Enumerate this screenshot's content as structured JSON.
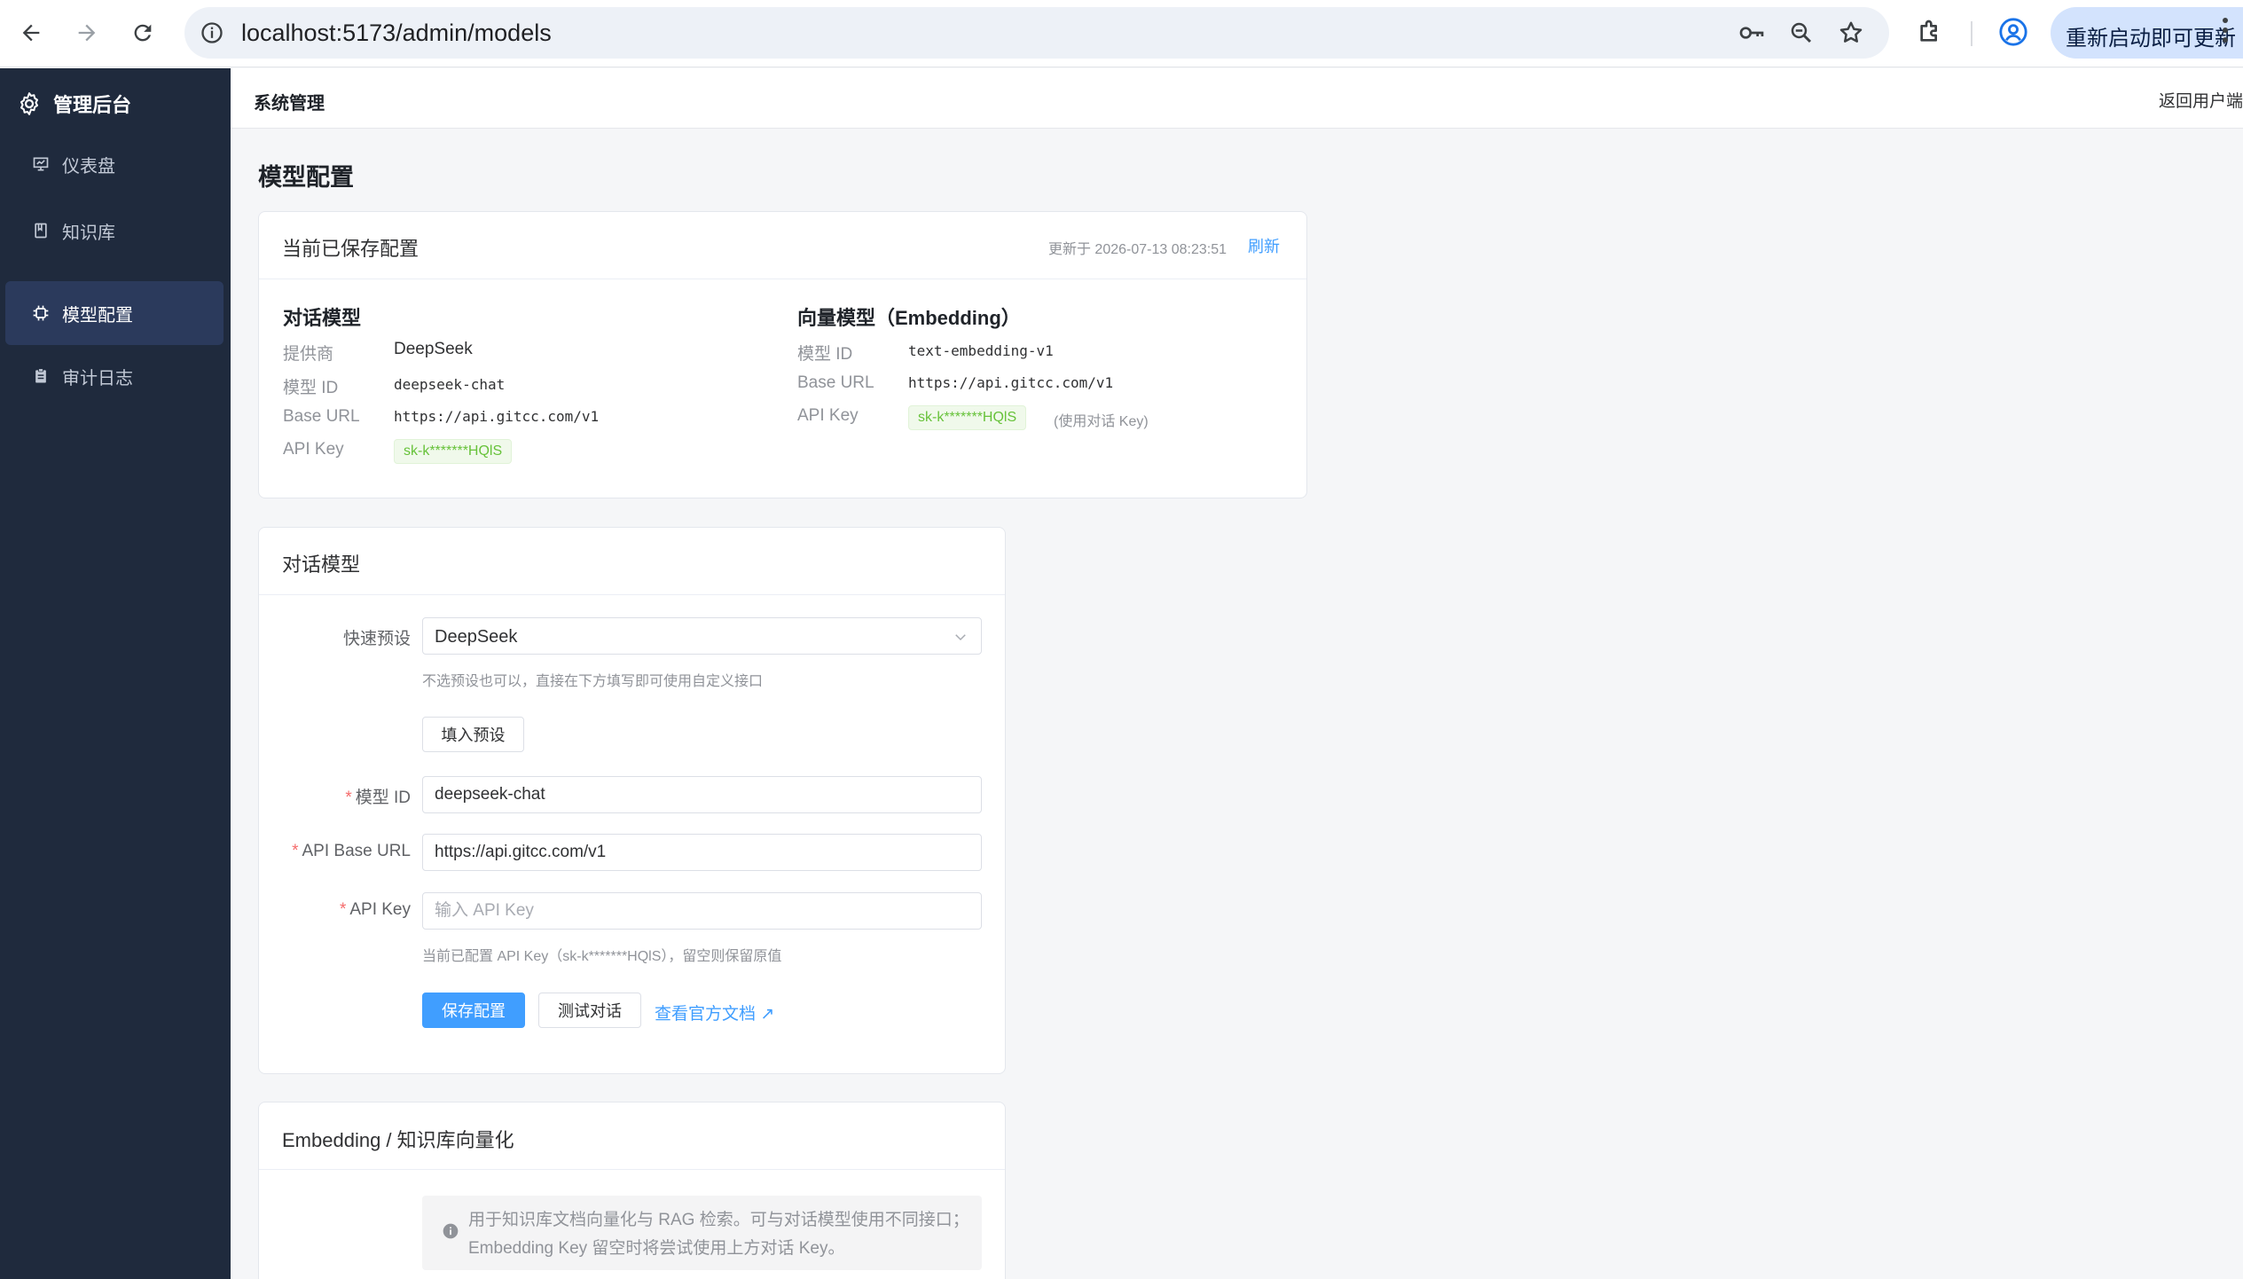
{
  "browser": {
    "url": "localhost:5173/admin/models",
    "update_label": "重新启动即可更新"
  },
  "sidebar": {
    "brand": "管理后台",
    "items": [
      {
        "label": "仪表盘",
        "icon": "dashboard-icon"
      },
      {
        "label": "知识库",
        "icon": "book-icon"
      },
      {
        "label": "模型配置",
        "icon": "chip-icon",
        "active": true
      },
      {
        "label": "审计日志",
        "icon": "clipboard-icon"
      }
    ]
  },
  "header": {
    "title": "系统管理",
    "back_link": "返回用户端"
  },
  "page": {
    "title": "模型配置"
  },
  "saved_config": {
    "title": "当前已保存配置",
    "updated_at": "更新于 2026-07-13 08:23:51",
    "refresh": "刷新",
    "chat": {
      "heading": "对话模型",
      "provider_label": "提供商",
      "provider": "DeepSeek",
      "model_id_label": "模型 ID",
      "model_id": "deepseek-chat",
      "base_url_label": "Base URL",
      "base_url": "https://api.gitcc.com/v1",
      "api_key_label": "API Key",
      "api_key": "sk-k*******HQlS"
    },
    "embedding": {
      "heading": "向量模型（Embedding）",
      "model_id_label": "模型 ID",
      "model_id": "text-embedding-v1",
      "base_url_label": "Base URL",
      "base_url": "https://api.gitcc.com/v1",
      "api_key_label": "API Key",
      "api_key": "sk-k*******HQlS",
      "api_key_note": "(使用对话 Key)"
    }
  },
  "chat_form": {
    "title": "对话模型",
    "preset_label": "快速预设",
    "preset_value": "DeepSeek",
    "preset_hint": "不选预设也可以，直接在下方填写即可使用自定义接口",
    "fill_preset": "填入预设",
    "model_id_label": "模型 ID",
    "model_id_value": "deepseek-chat",
    "base_url_label": "API Base URL",
    "base_url_value": "https://api.gitcc.com/v1",
    "api_key_label": "API Key",
    "api_key_placeholder": "输入 API Key",
    "api_key_hint": "当前已配置 API Key（sk-k*******HQlS），留空则保留原值",
    "save": "保存配置",
    "test": "测试对话",
    "docs": "查看官方文档 ↗"
  },
  "embedding_form": {
    "title": "Embedding / 知识库向量化",
    "info_line1": "用于知识库文档向量化与 RAG 检索。可与对话模型使用不同接口；",
    "info_line2": "Embedding Key 留空时将尝试使用上方对话 Key。"
  }
}
